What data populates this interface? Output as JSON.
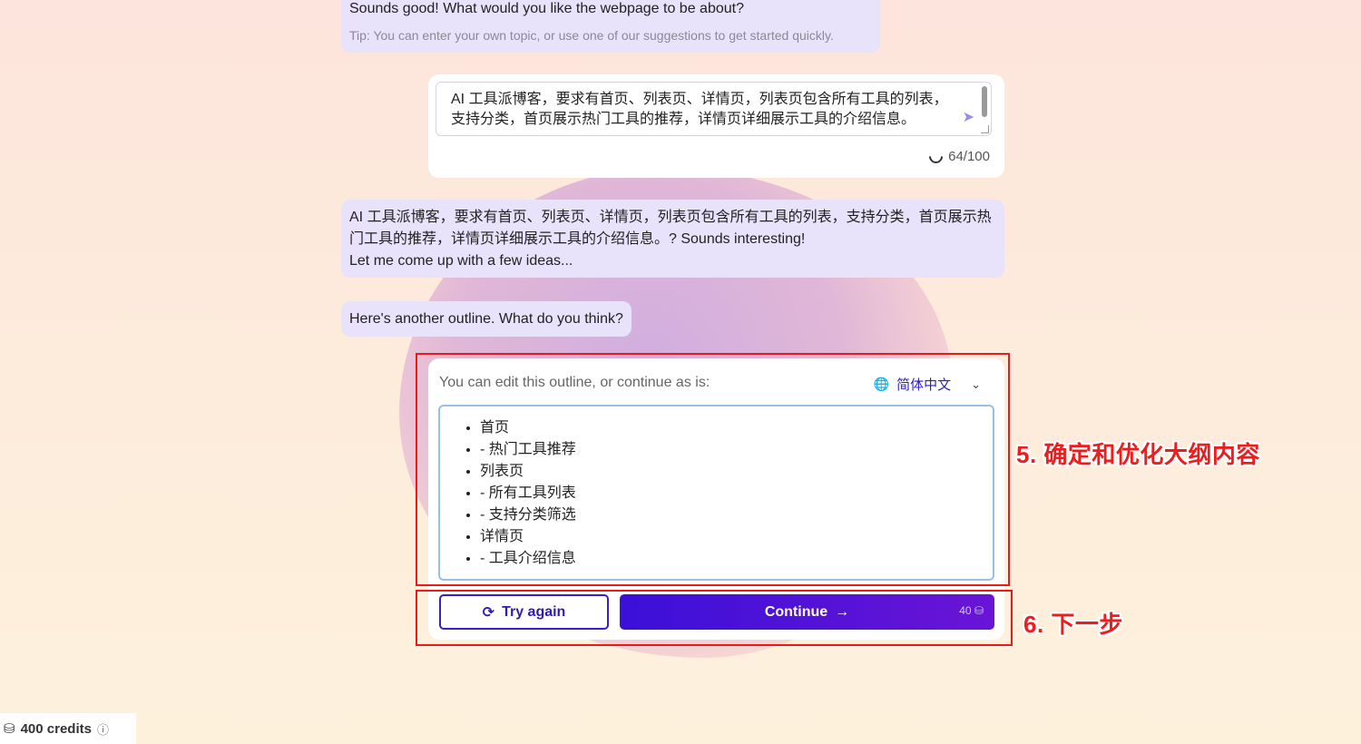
{
  "chat": {
    "bot_message_1": "Sounds good! What would you like the webpage to be about?",
    "bot_tip_1": "Tip: You can enter your own topic, or use one of our suggestions to get started quickly.",
    "input_value": "AI 工具派博客，要求有首页、列表页、详情页，列表页包含所有工具的列表，支持分类，首页展示热门工具的推荐，详情页详细展示工具的介绍信息。",
    "char_counter": "64/100",
    "bot_message_2": "AI 工具派博客，要求有首页、列表页、详情页，列表页包含所有工具的列表，支持分类，首页展示热门工具的推荐，详情页详细展示工具的介绍信息。? Sounds interesting!",
    "bot_message_2b": "Let me come up with a few ideas...",
    "bot_message_3": "Here's another outline. What do you think?"
  },
  "outline": {
    "prompt": "You can edit this outline, or continue as is:",
    "language": "简体中文",
    "items": [
      "首页",
      "- 热门工具推荐",
      "列表页",
      "- 所有工具列表",
      "- 支持分类筛选",
      "详情页",
      "- 工具介绍信息"
    ]
  },
  "buttons": {
    "try_again": "Try again",
    "continue": "Continue",
    "continue_cost": "40"
  },
  "annotations": {
    "step5": "5. 确定和优化大纲内容",
    "step6": "6. 下一步"
  },
  "footer": {
    "credits": "400 credits"
  },
  "colors": {
    "accent": "#3b10d8",
    "annotation": "#ee1c1c",
    "bubble": "#e8e2fb"
  },
  "icons": [
    "send-icon",
    "spinner-icon",
    "globe-icon",
    "chevron-down-icon",
    "refresh-icon",
    "arrow-right-icon",
    "credits-icon",
    "info-icon"
  ]
}
